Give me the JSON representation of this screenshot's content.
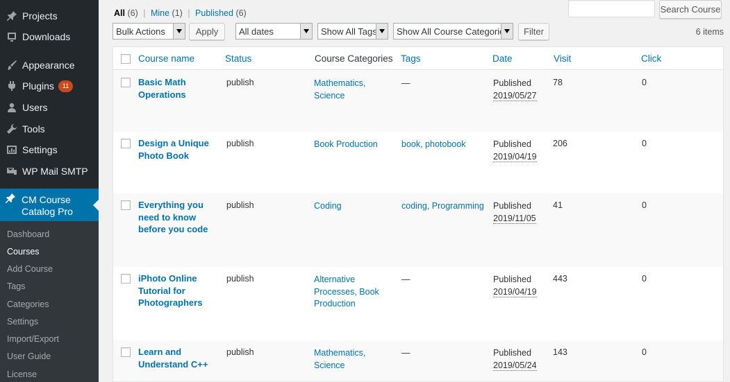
{
  "sidebar": {
    "items": [
      {
        "label": "Projects",
        "icon": "pin-icon"
      },
      {
        "label": "Downloads",
        "icon": "download-icon"
      },
      {
        "label": "Appearance",
        "icon": "paintbrush-icon"
      },
      {
        "label": "Plugins",
        "icon": "plug-icon",
        "badge": "11"
      },
      {
        "label": "Users",
        "icon": "user-icon"
      },
      {
        "label": "Tools",
        "icon": "wrench-icon"
      },
      {
        "label": "Settings",
        "icon": "settings-icon"
      },
      {
        "label": "WP Mail SMTP",
        "icon": "mail-icon"
      }
    ],
    "current": {
      "label": "CM Course Catalog Pro",
      "icon": "pin-icon"
    },
    "submenu": [
      "Dashboard",
      "Courses",
      "Add Course",
      "Tags",
      "Categories",
      "Settings",
      "Import/Export",
      "User Guide",
      "License"
    ]
  },
  "filters": {
    "all_label": "All",
    "all_count": "(6)",
    "mine_label": "Mine",
    "mine_count": "(1)",
    "published_label": "Published",
    "published_count": "(6)",
    "sep": "|"
  },
  "search": {
    "value": "",
    "button": "Search Course"
  },
  "toolbar": {
    "bulk_actions": "Bulk Actions",
    "apply": "Apply",
    "dates": "All dates",
    "tags": "Show All Tags",
    "categories": "Show All Course Categories",
    "filter": "Filter",
    "items_count": "6 items"
  },
  "table": {
    "columns": [
      "Course name",
      "Status",
      "Course Categories",
      "Tags",
      "Date",
      "Visit",
      "Click"
    ],
    "rows": [
      {
        "title": "Basic Math Operations",
        "status": "publish",
        "categories": "Mathematics, Science",
        "tags": "—",
        "date_label": "Published",
        "date": "2019/05/27",
        "visit": "78",
        "click": "0"
      },
      {
        "title": "Design a Unique Photo Book",
        "status": "publish",
        "categories": "Book Production",
        "tags": "book, photobook",
        "date_label": "Published",
        "date": "2019/04/19",
        "visit": "206",
        "click": "0"
      },
      {
        "title": "Everything you need to know before you code",
        "status": "publish",
        "categories": "Coding",
        "tags": "coding, Programming",
        "date_label": "Published",
        "date": "2019/11/05",
        "visit": "41",
        "click": "0"
      },
      {
        "title": "iPhoto Online Tutorial for Photographers",
        "status": "publish",
        "categories": "Alternative Processes, Book Production",
        "tags": "—",
        "date_label": "Published",
        "date": "2019/04/19",
        "visit": "443",
        "click": "0"
      },
      {
        "title": "Learn and Understand C++",
        "status": "publish",
        "categories": "Mathematics, Science",
        "tags": "—",
        "date_label": "Published",
        "date": "2019/05/24",
        "visit": "143",
        "click": "0"
      }
    ]
  },
  "colors": {
    "sidebar_bg": "#23282d",
    "accent": "#0073aa",
    "submenu_bg": "#32373c",
    "badge": "#ca4a1f"
  }
}
